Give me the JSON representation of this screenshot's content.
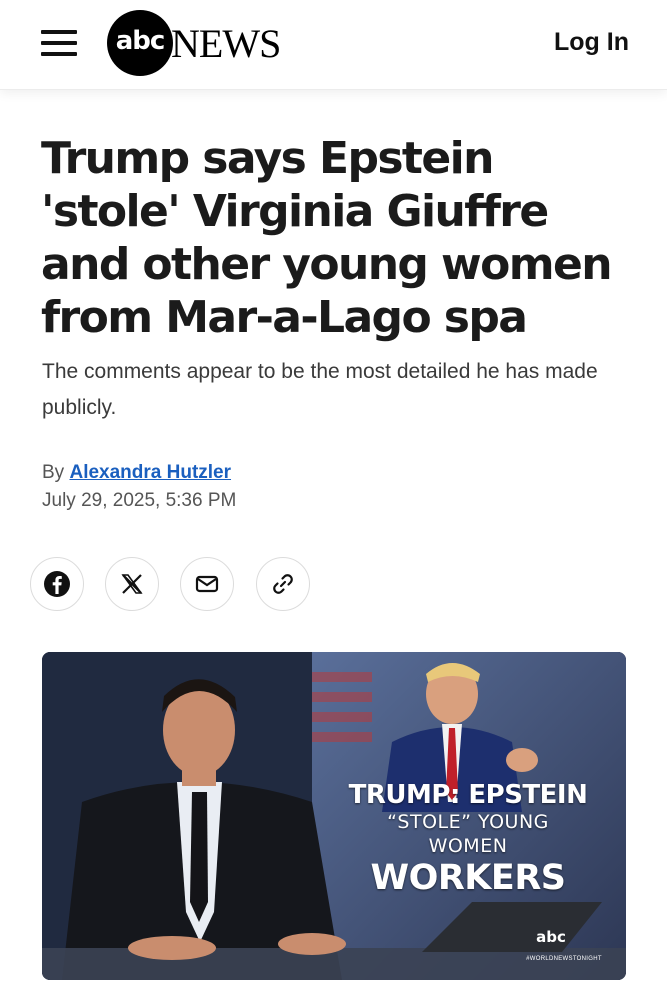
{
  "header": {
    "logo_circle": "abc",
    "logo_word": "NEWS",
    "login_label": "Log In"
  },
  "article": {
    "headline": "Trump says Epstein 'stole' Virginia Giuffre and other young women from Mar-a-Lago spa",
    "dek": "The comments appear to be the most detailed he has made publicly.",
    "byline_prefix": "By",
    "author": "Alexandra Hutzler",
    "date": "July 29, 2025, 5:36 PM"
  },
  "share": [
    {
      "icon": "facebook-icon"
    },
    {
      "icon": "x-icon"
    },
    {
      "icon": "mail-icon"
    },
    {
      "icon": "link-icon"
    }
  ],
  "hero": {
    "chyron_line1": "TRUMP: EPSTEIN",
    "chyron_line2": "“STOLE” YOUNG WOMEN",
    "chyron_line3": "WORKERS",
    "tv_logo": "abc",
    "tv_tag": "#WORLDNEWSTONIGHT"
  }
}
